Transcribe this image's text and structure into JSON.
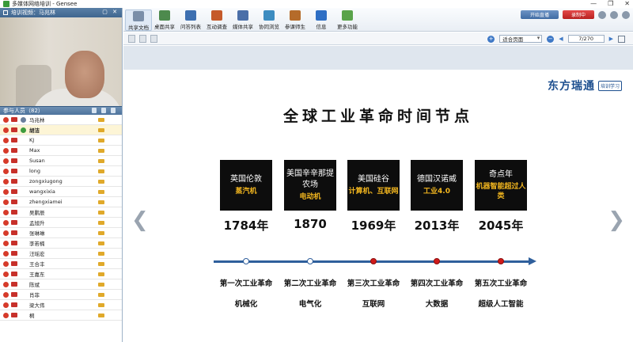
{
  "window": {
    "title": "多媒体网络培训 - Gensee",
    "controls": [
      "—",
      "❐",
      "✕"
    ]
  },
  "video_panel": {
    "header": "培训视频：马兆林"
  },
  "attendees": {
    "header": "参与人员（82）",
    "list": [
      {
        "name": "马兆林",
        "role": "host"
      },
      {
        "name": "胡洁",
        "role": "me"
      },
      {
        "name": "KJ"
      },
      {
        "name": "Max"
      },
      {
        "name": "Susan"
      },
      {
        "name": "long"
      },
      {
        "name": "zongxiugong"
      },
      {
        "name": "wangxixia"
      },
      {
        "name": "zhengxiamei"
      },
      {
        "name": "吴鹏辰"
      },
      {
        "name": "孟旭升"
      },
      {
        "name": "张琳琳"
      },
      {
        "name": "李若楠"
      },
      {
        "name": "汪瑶宏"
      },
      {
        "name": "王合丰"
      },
      {
        "name": "王嘉东"
      },
      {
        "name": "陈斌"
      },
      {
        "name": "肖菲"
      },
      {
        "name": "梁大伟"
      },
      {
        "name": "桐"
      }
    ]
  },
  "toolbar": {
    "tools": [
      {
        "label": "共享文档",
        "icon": "document-icon",
        "color": "#7a8ea8"
      },
      {
        "label": "桌面共享",
        "icon": "desktop-share-icon",
        "color": "#4d8a4d"
      },
      {
        "label": "问答列表",
        "icon": "qa-list-icon",
        "color": "#3d6fb0"
      },
      {
        "label": "互动调查",
        "icon": "survey-icon",
        "color": "#c55a2a"
      },
      {
        "label": "媒体共享",
        "icon": "media-share-icon",
        "color": "#4b6fa8"
      },
      {
        "label": "协同浏览",
        "icon": "cobrowse-icon",
        "color": "#3d8cc0"
      },
      {
        "label": "参课师生",
        "icon": "participants-icon",
        "color": "#b56b2a"
      },
      {
        "label": "信息",
        "icon": "info-icon",
        "color": "#2f6fc4"
      },
      {
        "label": "更多功能",
        "icon": "more-icon",
        "color": "#5aa34a"
      }
    ],
    "live_button": "开始直播",
    "record_button": "录制中"
  },
  "docbar": {
    "fit_select": "适合页面",
    "page": "7/270"
  },
  "slide": {
    "logo": "东方瑞通",
    "logo_badge": "培训学习",
    "title": "全球工业革命时间节点",
    "milestones": [
      {
        "place": "英国伦敦",
        "tech": "蒸汽机",
        "year": "1784年",
        "revolution": "第一次工业革命",
        "theme": "机械化",
        "marker": "hollow"
      },
      {
        "place": "美国辛辛那提农场",
        "tech": "电动机",
        "year": "1870",
        "revolution": "第二次工业革命",
        "theme": "电气化",
        "marker": "hollow"
      },
      {
        "place": "美国硅谷",
        "tech": "计算机、互联网",
        "year": "1969年",
        "revolution": "第三次工业革命",
        "theme": "互联网",
        "marker": "filled"
      },
      {
        "place": "德国汉诺威",
        "tech": "工业4.0",
        "year": "2013年",
        "revolution": "第四次工业革命",
        "theme": "大数据",
        "marker": "filled"
      },
      {
        "place": "奇点年",
        "tech": "机器智能超过人类",
        "year": "2045年",
        "revolution": "第五次工业革命",
        "theme": "超级人工智能",
        "marker": "filled"
      }
    ],
    "colors": {
      "box": "#0d0d0d",
      "tech_text": "#f2b61f",
      "timeline": "#2f5f9c",
      "marker_filled": "#d01a1a"
    }
  },
  "nav": {
    "prev": "❮",
    "next": "❯"
  }
}
